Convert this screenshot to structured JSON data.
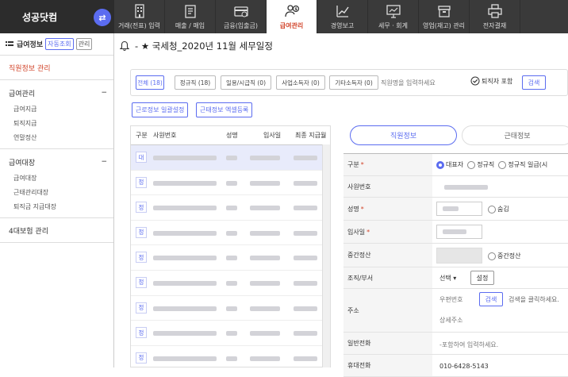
{
  "brand": {
    "name": "성공닷컴"
  },
  "menu": [
    {
      "label": "거래(전표) 입력",
      "icon": "building-icon"
    },
    {
      "label": "매출 / 매입",
      "icon": "invoice-icon"
    },
    {
      "label": "금융(입출금)",
      "icon": "card-icon"
    },
    {
      "label": "급여관리",
      "icon": "user-money-icon",
      "active": true
    },
    {
      "label": "경영보고",
      "icon": "growth-chart-icon"
    },
    {
      "label": "세무 · 회계",
      "icon": "presentation-icon"
    },
    {
      "label": "영업(재고) 관리",
      "icon": "box-icon"
    },
    {
      "label": "전자결재",
      "icon": "printer-icon"
    }
  ],
  "sidebar": {
    "title": "급여정보",
    "auto_label": "자동조회",
    "manage_label": "관리",
    "employee_info": "직원정보 관리",
    "sections": [
      {
        "label": "급여관리",
        "toggle": "−",
        "items": [
          "급여지급",
          "퇴직지급",
          "연말정산"
        ]
      },
      {
        "label": "급여대장",
        "toggle": "−",
        "items": [
          "급여대장",
          "근태관리대장",
          "퇴직금 지급대장"
        ]
      },
      {
        "label": "4대보험 관리",
        "toggle": "",
        "items": []
      }
    ]
  },
  "header": {
    "title": "국세청_2020년 11월 세무일정",
    "prefix": "-",
    "star": "★"
  },
  "filter": {
    "chips": [
      {
        "label": "전체 (18)",
        "selected": true
      },
      {
        "label": "정규직 (18)"
      },
      {
        "label": "일용/시급직 (0)"
      },
      {
        "label": "사업소득자 (0)"
      },
      {
        "label": "기타소득자 (0)"
      }
    ],
    "name_placeholder": "직원명을 입력하세요",
    "retired_label": "퇴직자 포함",
    "search_label": "검색"
  },
  "actions": {
    "monthly": "근로정보 일괄설정",
    "excel": "근태정보 엑셀등록"
  },
  "list": {
    "columns": [
      "구분",
      "사원번호",
      "성명",
      "입사일",
      "최종 지급월"
    ],
    "rows": [
      {
        "type": "대",
        "selected": true
      },
      {
        "type": "정"
      },
      {
        "type": "정"
      },
      {
        "type": "정"
      },
      {
        "type": "정"
      },
      {
        "type": "정"
      },
      {
        "type": "정"
      },
      {
        "type": "정"
      },
      {
        "type": "정"
      }
    ]
  },
  "tabs": {
    "info": "직원정보",
    "attendance": "근태정보"
  },
  "form": {
    "type_label": "구분",
    "type_options": [
      "대표자",
      "정규직",
      "정규직 일급(시"
    ],
    "emp_no_label": "사원번호",
    "name_label": "성명",
    "hide_label": "숨김",
    "join_label": "입사일",
    "mid_label": "중간정산",
    "mid_option": "중간정산",
    "org_label": "조직/부서",
    "org_select": "선택",
    "org_set": "설정",
    "addr_label": "주소",
    "zip_placeholder": "우편번호",
    "addr_search": "검색",
    "addr_hint": "검색을 클릭하세요.",
    "addr_detail": "상세주소",
    "phone_label": "일반전화",
    "phone_placeholder": "-포함하여 입력하세요.",
    "mobile_label": "휴대전화",
    "mobile_value": "010-6428-5143"
  }
}
